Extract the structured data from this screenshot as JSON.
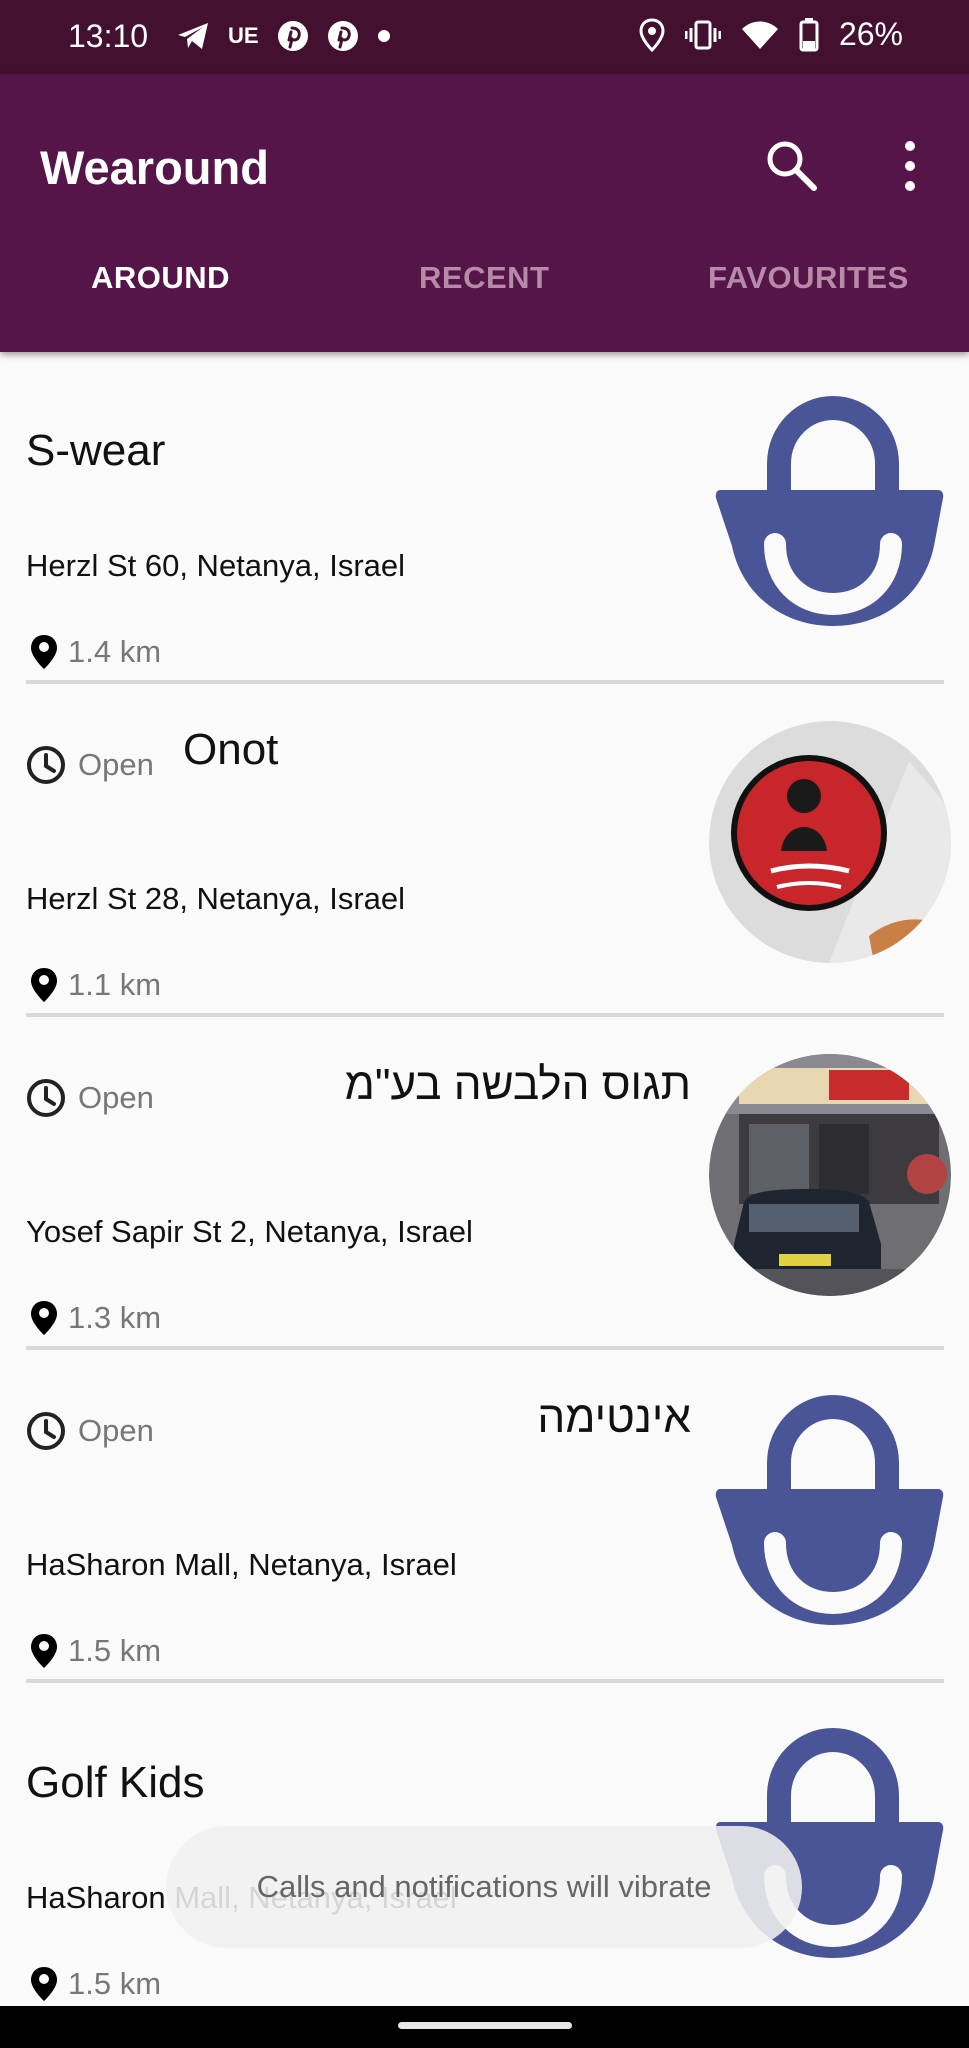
{
  "status_bar": {
    "time": "13:10",
    "carrier_badge": "UE",
    "battery": "26%",
    "icons_left": [
      "telegram-icon",
      "ue-badge",
      "pinterest-icon",
      "pinterest-icon",
      "dot-icon"
    ],
    "icons_right": [
      "location-icon",
      "vibrate-icon",
      "wifi-icon",
      "battery-icon"
    ]
  },
  "app_bar": {
    "title": "Wearound",
    "tabs": [
      {
        "label": "AROUND",
        "active": true
      },
      {
        "label": "RECENT",
        "active": false
      },
      {
        "label": "FAVOURITES",
        "active": false
      }
    ]
  },
  "stores": [
    {
      "name": "S-wear",
      "open": null,
      "address": "Herzl St 60, Netanya, Israel",
      "distance": "1.4 km",
      "thumbnail": "shopping-bag-icon"
    },
    {
      "name": "Onot",
      "open": "Open",
      "address": "Herzl St 28, Netanya, Israel",
      "distance": "1.1 km",
      "thumbnail": "bravo-bakery-photo"
    },
    {
      "name": "תגוס הלבשה בע\"מ",
      "open": "Open",
      "address": "Yosef Sapir St 2, Netanya, Israel",
      "distance": "1.3 km",
      "thumbnail": "storefront-photo"
    },
    {
      "name": "אינטימה",
      "open": "Open",
      "address": "HaSharon Mall, Netanya, Israel",
      "distance": "1.5 km",
      "thumbnail": "shopping-bag-icon"
    },
    {
      "name": "Golf Kids",
      "open": null,
      "address": "HaSharon Mall, Netanya, Israel",
      "distance": "1.5 km",
      "thumbnail": "shopping-bag-icon"
    }
  ],
  "toast": "Calls and notifications will vibrate",
  "colors": {
    "status_bar": "#43112f",
    "app_bar": "#561548",
    "bag_icon": "#4a5597",
    "tab_inactive": "#b68ba8"
  }
}
